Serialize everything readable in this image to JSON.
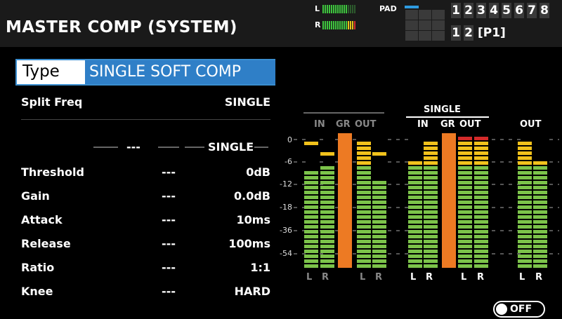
{
  "header": {
    "title": "MASTER COMP (SYSTEM)",
    "meter_l": "L",
    "meter_r": "R",
    "pad_label": "PAD",
    "numbers_top": [
      "1",
      "2",
      "3",
      "4",
      "5",
      "6",
      "7",
      "8"
    ],
    "numbers_bottom": [
      "1",
      "2"
    ],
    "page": "[P1]"
  },
  "type": {
    "label": "Type",
    "value": "SINGLE SOFT COMP"
  },
  "split": {
    "label": "Split Freq",
    "value": "SINGLE"
  },
  "band_header": {
    "dash": "---",
    "value": "SINGLE"
  },
  "params": [
    {
      "label": "Threshold",
      "dash": "---",
      "value": "0dB"
    },
    {
      "label": "Gain",
      "dash": "---",
      "value": "0.0dB"
    },
    {
      "label": "Attack",
      "dash": "---",
      "value": "10ms"
    },
    {
      "label": "Release",
      "dash": "---",
      "value": "100ms"
    },
    {
      "label": "Ratio",
      "dash": "---",
      "value": "1:1"
    },
    {
      "label": "Knee",
      "dash": "---",
      "value": "HARD"
    }
  ],
  "meters": {
    "scale": [
      "0",
      "-6",
      "-12",
      "-18",
      "-36",
      "-54"
    ],
    "group_left": {
      "cols": [
        "IN",
        "GR",
        "OUT"
      ],
      "lr": [
        "L",
        "R",
        "L",
        "R"
      ]
    },
    "group_single": {
      "title": "SINGLE",
      "cols": [
        "IN",
        "GR",
        "OUT"
      ],
      "lr": [
        "L",
        "R",
        "L",
        "R"
      ]
    },
    "group_out": {
      "title": "OUT",
      "lr": [
        "L",
        "R"
      ]
    },
    "colors": {
      "green": "#7cc34a",
      "yellow": "#f2c21c",
      "red": "#d42a2a",
      "orange": "#ed7a23"
    }
  },
  "toggle": {
    "label": "OFF"
  }
}
